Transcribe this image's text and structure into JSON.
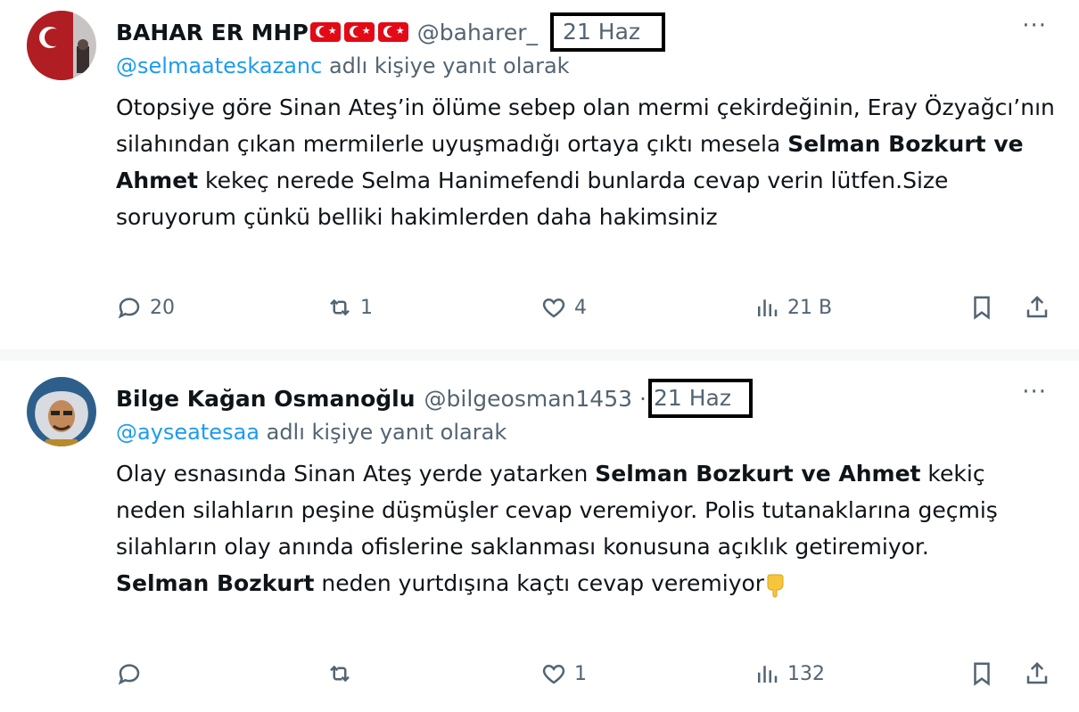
{
  "tweets": [
    {
      "author_name": "BAHAR ER MHP",
      "author_flags": [
        "flag-tr",
        "flag-tr",
        "flag-tr"
      ],
      "handle": "@baharer_",
      "time": "21 Haz",
      "reply_prefix": "@selmaateskazanc",
      "reply_suffix": " adlı kişiye yanıt olarak",
      "text_parts": [
        "Otopsiye göre Sinan Ateş’in ölüme sebep olan mermi çekirdeğinin, Eray Özyağcı’nın silahından çıkan mermilerle uyuşmadığı ortaya çıktı mesela ",
        "Selman Bozkurt ve Ahmet",
        " kekeç nerede Selma Hanimefendi bunlarda cevap verin lütfen.Size soruyorum çünkü belliki hakimlerden daha hakimsiniz"
      ],
      "replies": "20",
      "retweets": "1",
      "likes": "4",
      "views": "21 B"
    },
    {
      "author_name": "Bilge Kağan Osmanoğlu",
      "handle": "@bilgeosman1453",
      "separator": "·",
      "time": "21 Haz",
      "reply_prefix": "@ayseatesaa",
      "reply_suffix": " adlı kişiye yanıt olarak",
      "text_parts": [
        "Olay esnasında Sinan Ateş yerde yatarken ",
        "Selman Bozkurt ve Ahmet",
        " kekiç neden silahların peşine düşmüşler cevap veremiyor. Polis tutanaklarına geçmiş silahların olay anında ofislerine saklanması konusuna açıklık getiremiyor.",
        "Selman Bozkurt",
        " neden yurtdışına kaçtı cevap veremiyor"
      ],
      "emoji": "backhand-index-pointing-down",
      "replies": "",
      "retweets": "",
      "likes": "1",
      "views": "132"
    }
  ],
  "more_label": "···",
  "colors": {
    "text": "#0f1419",
    "secondary": "#536471",
    "link": "#1d9bf0",
    "separator": "#f7f9f9"
  }
}
